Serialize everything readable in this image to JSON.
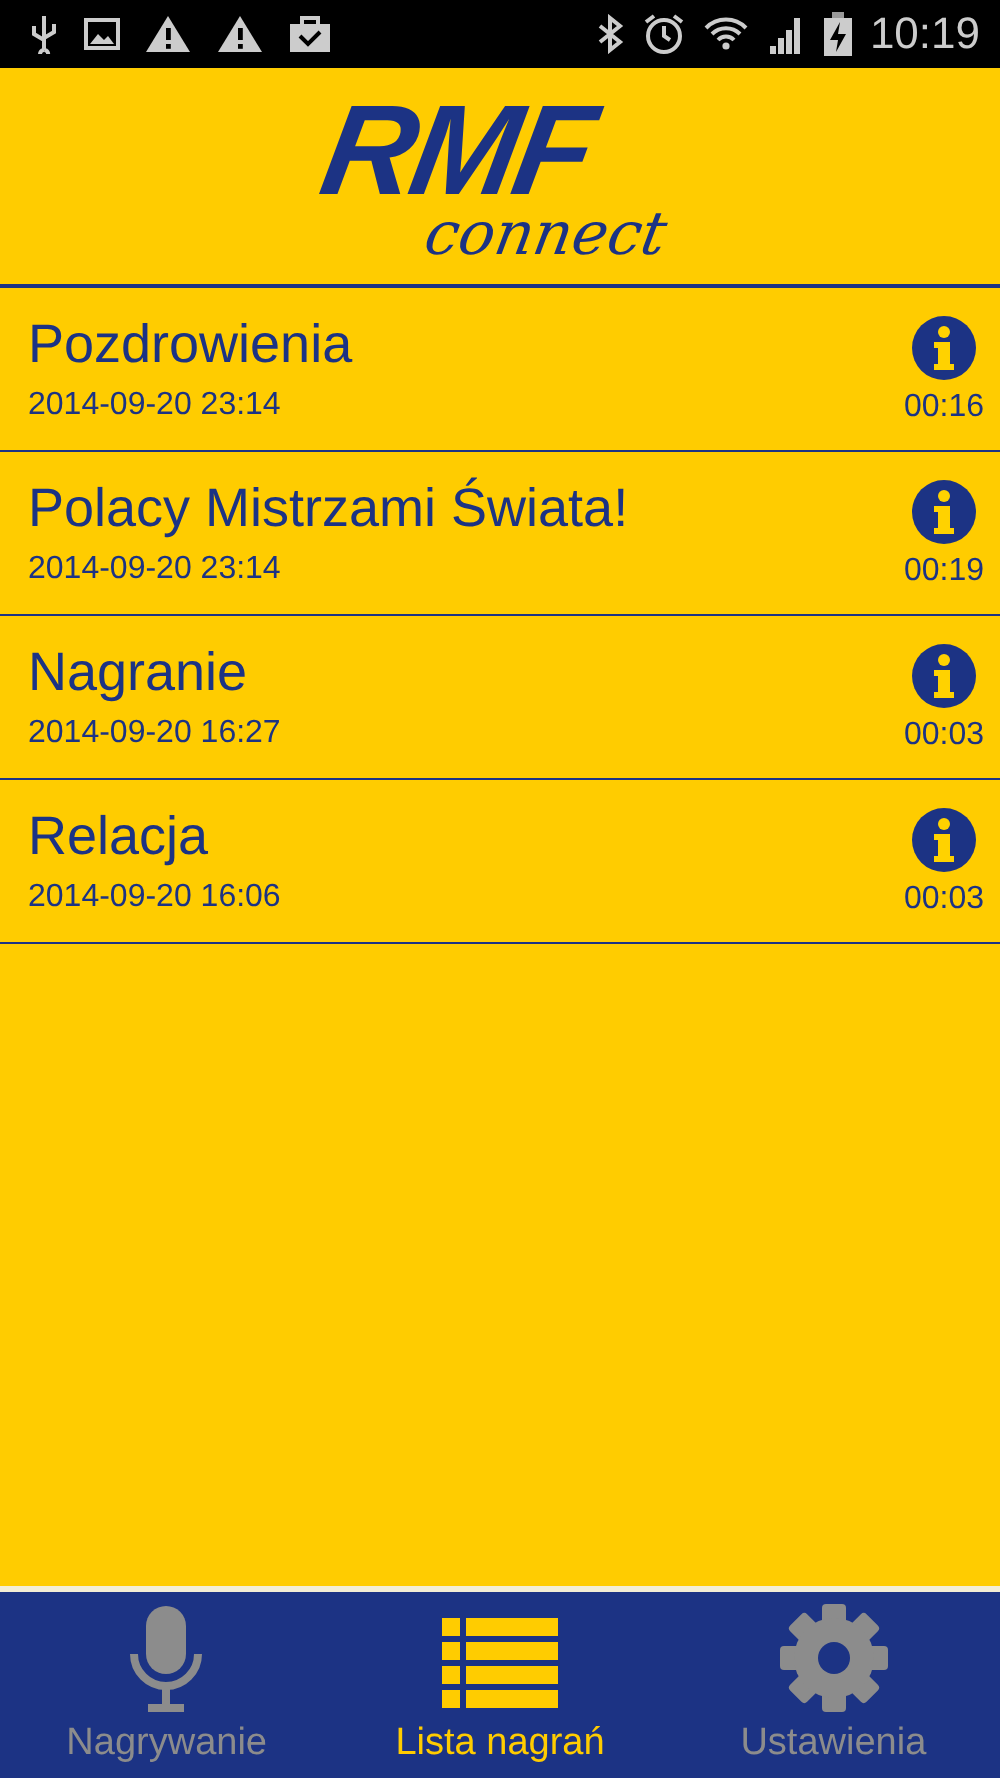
{
  "status_bar": {
    "time": "10:19"
  },
  "logo": {
    "title": "RMF",
    "subtitle": "connect"
  },
  "recordings": [
    {
      "title": "Pozdrowienia",
      "date": "2014-09-20 23:14",
      "duration": "00:16"
    },
    {
      "title": "Polacy Mistrzami Świata!",
      "date": "2014-09-20 23:14",
      "duration": "00:19"
    },
    {
      "title": "Nagranie",
      "date": "2014-09-20 16:27",
      "duration": "00:03"
    },
    {
      "title": "Relacja",
      "date": "2014-09-20 16:06",
      "duration": "00:03"
    }
  ],
  "nav": [
    {
      "kind": "mic",
      "label": "Nagrywanie",
      "selected": false
    },
    {
      "kind": "list",
      "label": "Lista nagrań",
      "selected": true
    },
    {
      "kind": "gear",
      "label": "Ustawienia",
      "selected": false
    }
  ]
}
